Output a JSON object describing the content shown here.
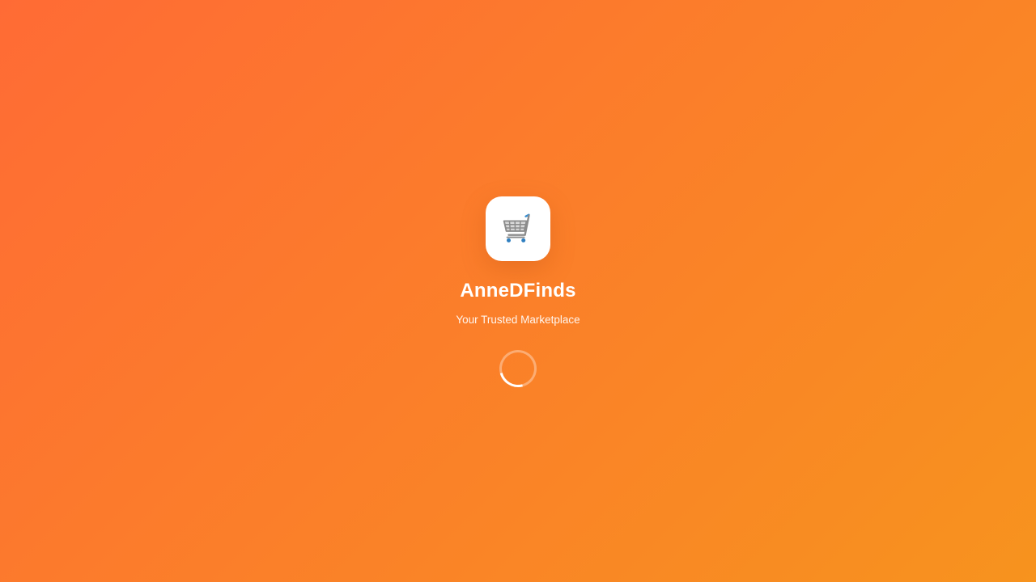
{
  "app": {
    "name": "AnneDFinds",
    "tagline": "Your Trusted Marketplace",
    "logo_icon": "shopping-cart-icon"
  },
  "loading": {
    "indicator": "spinner-icon"
  },
  "colors": {
    "gradient_start": "#ff6b35",
    "gradient_end": "#f7931e",
    "logo_background": "#ffffff",
    "text": "#ffffff"
  }
}
